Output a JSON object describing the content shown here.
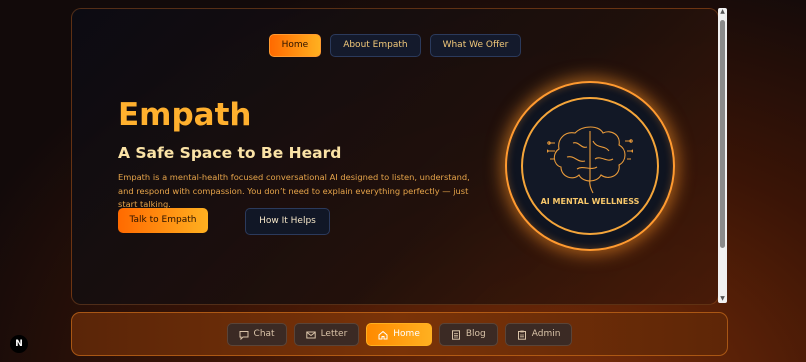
{
  "top_nav": {
    "home": "Home",
    "about": "About Empath",
    "offer": "What We Offer"
  },
  "hero": {
    "title": "Empath",
    "subtitle": "A Safe Space to Be Heard",
    "description": "Empath is a mental-health focused conversational AI designed to listen, understand, and respond with compassion. You don’t need to explain everything perfectly — just start talking.",
    "primary_button": "Talk to Empath",
    "secondary_button": "How It Helps"
  },
  "badge": {
    "text": "AI MENTAL WELLNESS",
    "icon": "brain-icon"
  },
  "bottom_nav": [
    {
      "label": "Chat",
      "icon": "chat-icon"
    },
    {
      "label": "Letter",
      "icon": "mail-icon"
    },
    {
      "label": "Home",
      "icon": "home-icon"
    },
    {
      "label": "Blog",
      "icon": "document-icon"
    },
    {
      "label": "Admin",
      "icon": "clipboard-icon"
    }
  ],
  "logo": {
    "text": "N"
  },
  "colors": {
    "accent": "#ff8a00",
    "gold": "#ffb02e",
    "navy": "#141a2c"
  }
}
